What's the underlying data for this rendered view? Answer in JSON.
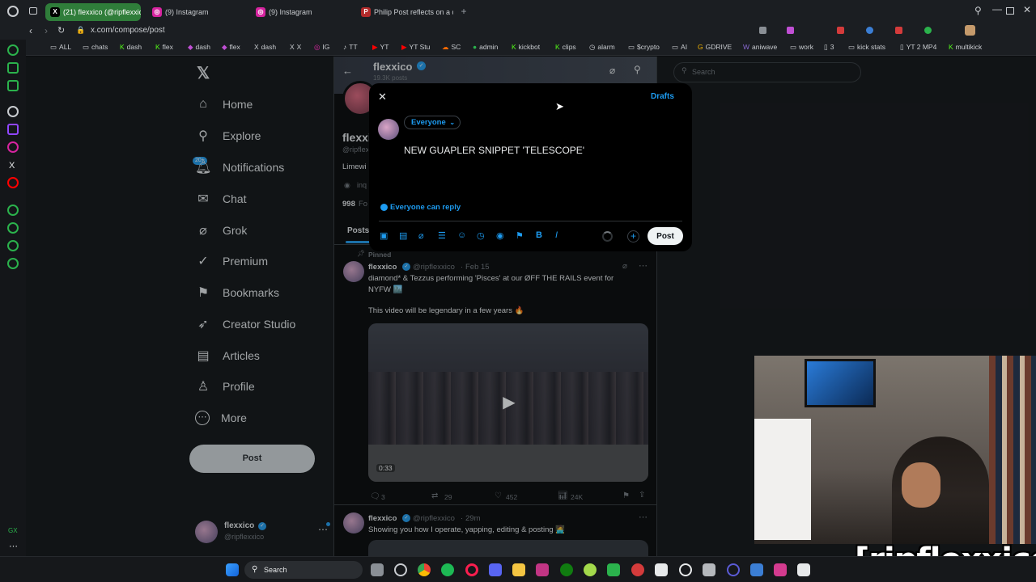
{
  "browser": {
    "tabs": [
      {
        "label": "(21) flexxico (@ripflexxico",
        "icon": "x-icon",
        "active": true
      },
      {
        "label": "(9) Instagram",
        "icon": "instagram-icon",
        "active": false
      },
      {
        "label": "(9) Instagram",
        "icon": "instagram-icon",
        "active": false
      },
      {
        "label": "Philip Post reflects on a de",
        "icon": "page-icon",
        "active": false
      }
    ],
    "url": "x.com/compose/post",
    "bookmarks": [
      "ALL",
      "chats",
      "dash",
      "flex",
      "dash",
      "flex",
      "dash",
      "X",
      "IG",
      "TT",
      "YT",
      "YT Stu",
      "SC",
      "admin",
      "kickbot",
      "clips",
      "alarm",
      "$crypto",
      "AI",
      "GDRIVE",
      "aniwave",
      "work",
      "3",
      "kick stats",
      "YT 2 MP4",
      "multikick"
    ]
  },
  "nav": {
    "items": [
      {
        "label": "Home",
        "icon": "home-icon",
        "glyph": "⌂"
      },
      {
        "label": "Explore",
        "icon": "search-icon",
        "glyph": "⚲"
      },
      {
        "label": "Notifications",
        "icon": "bell-icon",
        "glyph": "♫"
      },
      {
        "label": "Chat",
        "icon": "mail-icon",
        "glyph": "✉"
      },
      {
        "label": "Grok",
        "icon": "grok-icon",
        "glyph": "⌀"
      },
      {
        "label": "Premium",
        "icon": "verified-icon",
        "glyph": "✓"
      },
      {
        "label": "Bookmarks",
        "icon": "bookmark-icon",
        "glyph": "⚑"
      },
      {
        "label": "Creator Studio",
        "icon": "rocket-icon",
        "glyph": "➶"
      },
      {
        "label": "Articles",
        "icon": "article-icon",
        "glyph": "▤"
      },
      {
        "label": "Profile",
        "icon": "person-icon",
        "glyph": "♙"
      },
      {
        "label": "More",
        "icon": "more-icon",
        "glyph": "⋯"
      }
    ],
    "notif_badge": "20+",
    "post_label": "Post",
    "account_name": "flexxico",
    "account_handle": "@ripflexxico"
  },
  "profile_header": {
    "name": "flexxico",
    "posts_count": "19.3K posts",
    "bio_fragment": "Limewi",
    "location_fragment": "inq",
    "followers_fragment": "998",
    "tab_posts": "Posts"
  },
  "search": {
    "placeholder": "Search"
  },
  "compose": {
    "drafts": "Drafts",
    "audience": "Everyone",
    "text": "NEW GUAPLER SNIPPET 'TELESCOPE'",
    "reply_setting": "Everyone can reply",
    "post_label": "Post",
    "toolbar_icons": [
      "image-icon",
      "gif-icon",
      "grok-icon",
      "poll-icon",
      "emoji-icon",
      "schedule-icon",
      "location-icon",
      "flag-icon",
      "bold-icon",
      "italic-icon"
    ]
  },
  "tweets": [
    {
      "pinned_label": "Pinned",
      "name": "flexxico",
      "handle": "@ripflexxico",
      "date": "Feb 15",
      "line1": "diamond* & Tezzus performing 'Pisces' at our ØFF THE RAILS event for",
      "line2": "NYFW 🏙️",
      "line3": "This video will be legendary in a few years 🔥",
      "video_duration": "0:33",
      "replies": "3",
      "reposts": "29",
      "likes": "452",
      "views": "24K"
    },
    {
      "name": "flexxico",
      "handle": "@ripflexxico",
      "date": "29m",
      "line1": "Showing you how I operate, yapping, editing & posting 🧑‍💻"
    }
  ],
  "taskbar": {
    "search_label": "Search"
  },
  "stream_overlay": {
    "tag": "[ripflexxico]"
  },
  "colors": {
    "accent": "#1d9bf0",
    "tab_active": "#2f7d3a",
    "background": "#000000"
  }
}
